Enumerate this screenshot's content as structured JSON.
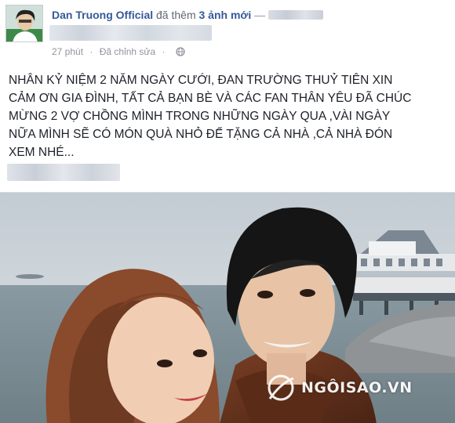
{
  "post": {
    "author": "Dan Truong Official",
    "action_prefix": "đã thêm",
    "added_label": "3 ảnh mới",
    "separator": "—",
    "time": "27 phút",
    "dot": "·",
    "edited": "Đã chỉnh sửa",
    "privacy_icon": "globe-icon",
    "status_lines": [
      "NHÂN KỶ NIỆM 2 NĂM NGÀY CƯỚI, ĐAN TRƯỜNG THUỶ TIÊN XIN",
      "CẢM ƠN GIA ĐÌNH, TẤT CẢ BẠN BÈ VÀ CÁC FAN THÂN YÊU ĐÃ CHÚC",
      "MỪNG 2 VỢ CHỒNG MÌNH TRONG NHỮNG NGÀY QUA ,VÀI NGÀY",
      "NỮA MÌNH SẼ CÓ MÓN QUÀ NHỎ ĐỂ TẶNG CẢ NHÀ ,CẢ NHÀ ĐÓN",
      "XEM NHÉ..."
    ]
  },
  "watermark": {
    "text": "NGÔISAO.VN"
  },
  "colors": {
    "link": "#365899",
    "meta": "#90949c",
    "text": "#1d2129"
  }
}
